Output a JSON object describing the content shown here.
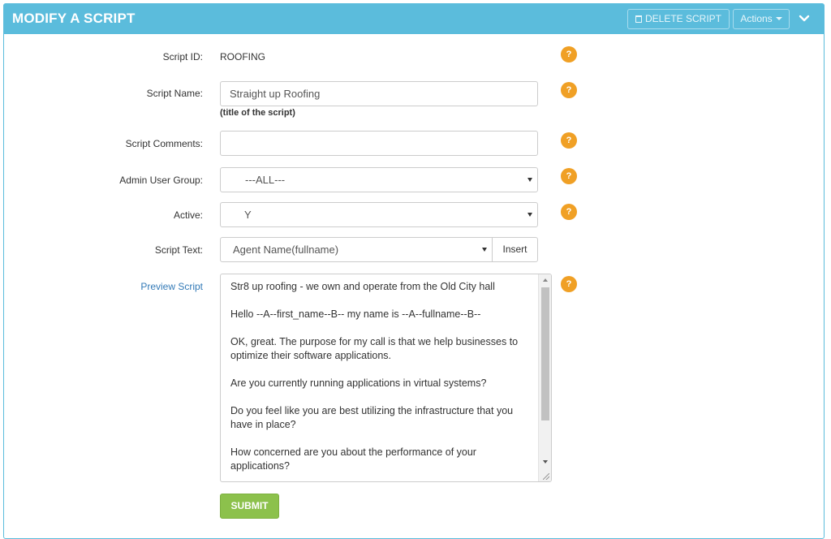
{
  "header": {
    "title": "MODIFY A SCRIPT",
    "delete_label": "DELETE SCRIPT",
    "actions_label": "Actions",
    "accent_color": "#5bbcdc"
  },
  "form": {
    "script_id": {
      "label": "Script ID:",
      "value": "ROOFING"
    },
    "script_name": {
      "label": "Script Name:",
      "value": "Straight up Roofing",
      "hint": "(title of the script)"
    },
    "script_comments": {
      "label": "Script Comments:",
      "value": ""
    },
    "admin_user_group": {
      "label": "Admin User Group:",
      "value": "---ALL---"
    },
    "active": {
      "label": "Active:",
      "value": "Y"
    },
    "script_text": {
      "label": "Script Text:",
      "value": "Agent Name(fullname)",
      "insert_label": "Insert"
    },
    "preview_label": "Preview Script",
    "help_glyph": "?",
    "script_body": [
      "Str8 up roofing - we own and operate from the Old City hall",
      "Hello --A--first_name--B-- my name is --A--fullname--B--",
      "OK, great. The purpose for my call is that we help businesses to optimize their software applications.",
      "Are you currently running applications in virtual systems?",
      "Do you feel like you are best utilizing the infrastructure that you have in place?",
      "How concerned are you about the performance of your applications?"
    ],
    "submit_label": "SUBMIT",
    "submit_color": "#8cc14c",
    "help_color": "#f0a025"
  }
}
